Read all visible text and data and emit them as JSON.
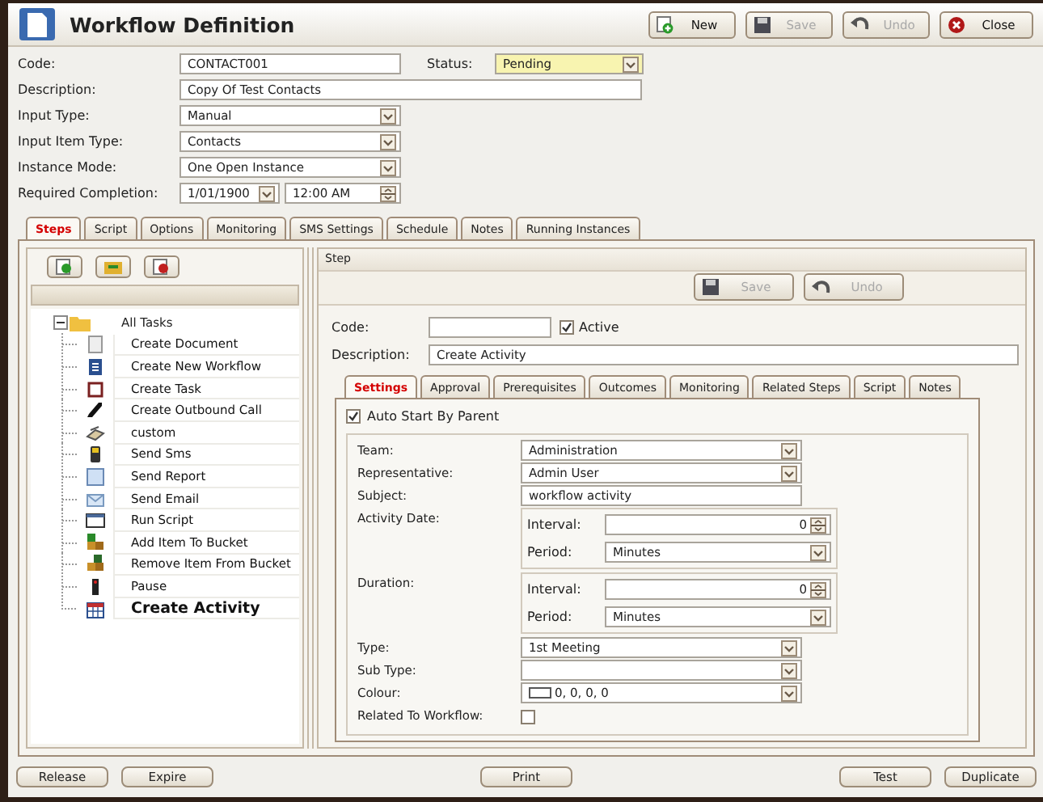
{
  "window": {
    "title": "Workflow Definition"
  },
  "toolbar": [
    {
      "label": "New",
      "disabled": false
    },
    {
      "label": "Save",
      "disabled": true
    },
    {
      "label": "Undo",
      "disabled": true
    },
    {
      "label": "Close",
      "disabled": false
    }
  ],
  "form": {
    "code": {
      "label": "Code:",
      "value": "CONTACT001"
    },
    "status": {
      "label": "Status:",
      "value": "Pending"
    },
    "rows": [
      {
        "label": "Description:",
        "kind": "text",
        "value": "Copy Of Test Contacts"
      },
      {
        "label": "Input Type:",
        "kind": "select",
        "value": "Manual"
      },
      {
        "label": "Input Item Type:",
        "kind": "select",
        "value": "Contacts"
      },
      {
        "label": "Instance Mode:",
        "kind": "select",
        "value": "One Open Instance"
      },
      {
        "label": "Required Completion:",
        "kind": "datetime",
        "date": "1/01/1900",
        "time": "12:00 AM"
      }
    ]
  },
  "tabs": [
    {
      "label": "Steps",
      "selected": true
    },
    {
      "label": "Script",
      "selected": false
    },
    {
      "label": "Options",
      "selected": false
    },
    {
      "label": "Monitoring",
      "selected": false
    },
    {
      "label": "SMS Settings",
      "selected": false
    },
    {
      "label": "Schedule",
      "selected": false
    },
    {
      "label": "Notes",
      "selected": false
    },
    {
      "label": "Running Instances",
      "selected": false
    }
  ],
  "steps_tree": {
    "label": "All Tasks",
    "expanded": true,
    "children": [
      {
        "label": "Create Document",
        "selected": false
      },
      {
        "label": "Create New Workflow",
        "selected": false
      },
      {
        "label": "Create Task",
        "selected": false
      },
      {
        "label": "Create Outbound Call",
        "selected": false
      },
      {
        "label": "custom",
        "selected": false
      },
      {
        "label": "Send Sms",
        "selected": false
      },
      {
        "label": "Send Report",
        "selected": false
      },
      {
        "label": "Send Email",
        "selected": false
      },
      {
        "label": "Run Script",
        "selected": false
      },
      {
        "label": "Add Item To Bucket",
        "selected": false
      },
      {
        "label": "Remove Item From Bucket",
        "selected": false
      },
      {
        "label": "Pause",
        "selected": false
      },
      {
        "label": "Create Activity",
        "selected": true
      }
    ]
  },
  "step": {
    "title": "Step",
    "toolbar": [
      {
        "label": "Save",
        "disabled": true
      },
      {
        "label": "Undo",
        "disabled": true
      }
    ],
    "code": {
      "label": "Code:"
    },
    "active": {
      "label": "Active",
      "checked": true
    },
    "description": {
      "label": "Description:",
      "value": "Create Activity"
    },
    "tabs": [
      {
        "label": "Settings",
        "selected": true
      },
      {
        "label": "Approval",
        "selected": false
      },
      {
        "label": "Prerequisites",
        "selected": false
      },
      {
        "label": "Outcomes",
        "selected": false
      },
      {
        "label": "Monitoring",
        "selected": false
      },
      {
        "label": "Related Steps",
        "selected": false
      },
      {
        "label": "Script",
        "selected": false
      },
      {
        "label": "Notes",
        "selected": false
      }
    ],
    "auto_start": {
      "label": "Auto Start By Parent",
      "checked": true
    },
    "settings": [
      {
        "label": "Team:",
        "kind": "select",
        "value": "Administration"
      },
      {
        "label": "Representative:",
        "kind": "select",
        "value": "Admin User"
      },
      {
        "label": "Subject:",
        "kind": "text",
        "value": "workflow activity"
      },
      {
        "label": "Activity Date:",
        "kind": "interval",
        "interval_label": "Interval:",
        "interval": "0",
        "period_label": "Period:",
        "period": "Minutes"
      },
      {
        "label": "Duration:",
        "kind": "interval",
        "interval_label": "Interval:",
        "interval": "0",
        "period_label": "Period:",
        "period": "Minutes"
      },
      {
        "label": "Type:",
        "kind": "select",
        "value": "1st Meeting"
      },
      {
        "label": "Sub Type:",
        "kind": "select"
      },
      {
        "label": "Colour:",
        "kind": "colour",
        "value": "0, 0, 0, 0"
      },
      {
        "label": "Related To Workflow:",
        "kind": "checkbox",
        "checked": false
      }
    ]
  },
  "bottom_buttons": [
    "Release",
    "Expire",
    "Print",
    "Test",
    "Duplicate"
  ]
}
